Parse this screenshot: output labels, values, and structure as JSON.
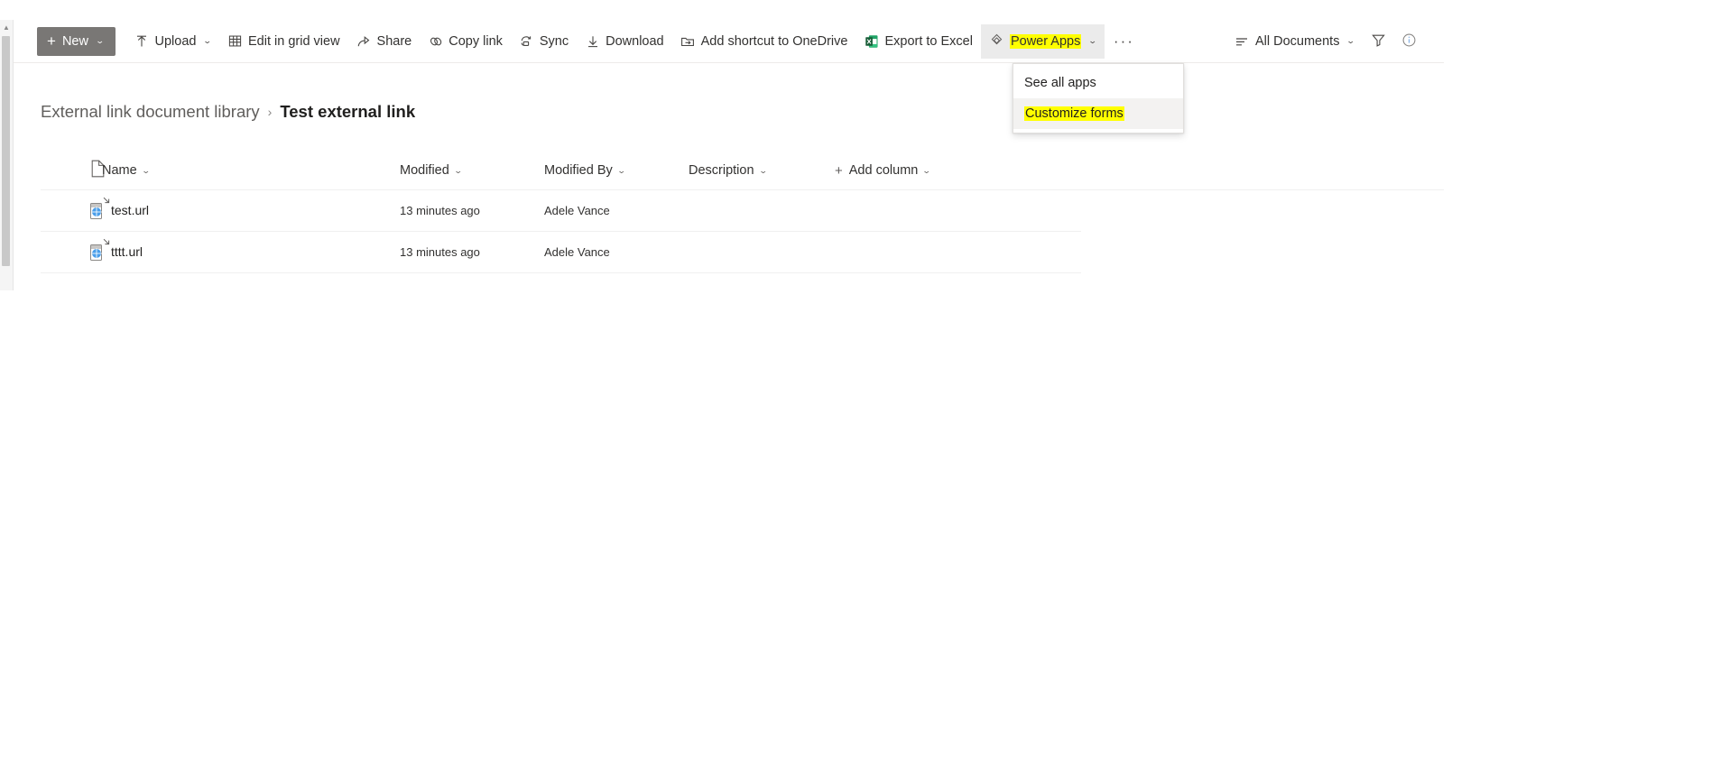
{
  "scrollbar": {
    "up_arrow": "▲"
  },
  "toolbar": {
    "new_label": "New",
    "new_plus": "+",
    "chevron": "⌄",
    "commands": [
      {
        "id": "upload",
        "label": "Upload",
        "icon": "upload-icon",
        "has_chevron": true
      },
      {
        "id": "grid",
        "label": "Edit in grid view",
        "icon": "grid-icon",
        "has_chevron": false
      },
      {
        "id": "share",
        "label": "Share",
        "icon": "share-icon",
        "has_chevron": false
      },
      {
        "id": "copylink",
        "label": "Copy link",
        "icon": "link-icon",
        "has_chevron": false
      },
      {
        "id": "sync",
        "label": "Sync",
        "icon": "sync-icon",
        "has_chevron": false
      },
      {
        "id": "download",
        "label": "Download",
        "icon": "download-icon",
        "has_chevron": false
      },
      {
        "id": "shortcut",
        "label": "Add shortcut to OneDrive",
        "icon": "add-shortcut-icon",
        "has_chevron": false
      },
      {
        "id": "excel",
        "label": "Export to Excel",
        "icon": "excel-icon",
        "has_chevron": false
      }
    ],
    "powerapps": {
      "label": "Power Apps",
      "icon": "power-apps-icon",
      "highlighted": true,
      "expanded": true
    },
    "overflow_label": "···",
    "view_label": "All Documents",
    "view_icon": "view-list-icon",
    "filter_icon": "filter-icon",
    "info_icon": "info-icon"
  },
  "powerapps_menu": {
    "items": [
      {
        "label": "See all apps",
        "highlighted": false,
        "hovered": false
      },
      {
        "label": "Customize forms",
        "highlighted": true,
        "hovered": true
      }
    ]
  },
  "breadcrumb": {
    "parent": "External link document library",
    "separator": "›",
    "current": "Test external link"
  },
  "list": {
    "columns": [
      {
        "id": "icon",
        "label": "",
        "chevron": false,
        "plus": false
      },
      {
        "id": "name",
        "label": "Name",
        "chevron": true,
        "plus": false
      },
      {
        "id": "modified",
        "label": "Modified",
        "chevron": true,
        "plus": false
      },
      {
        "id": "modifiedby",
        "label": "Modified By",
        "chevron": true,
        "plus": false
      },
      {
        "id": "desc",
        "label": "Description",
        "chevron": true,
        "plus": false
      },
      {
        "id": "add",
        "label": "Add column",
        "chevron": true,
        "plus": true
      }
    ],
    "rows": [
      {
        "icon": "url-file-icon",
        "shortcut": true,
        "name": "test.url",
        "modified": "13 minutes ago",
        "modified_by": "Adele Vance",
        "description": ""
      },
      {
        "icon": "url-file-icon",
        "shortcut": true,
        "name": "tttt.url",
        "modified": "13 minutes ago",
        "modified_by": "Adele Vance",
        "description": ""
      }
    ]
  },
  "colors": {
    "new_button_bg": "#797775",
    "highlight_yellow": "#ffff00",
    "excel_green": "#217346",
    "globe_blue": "#4a9eea"
  }
}
